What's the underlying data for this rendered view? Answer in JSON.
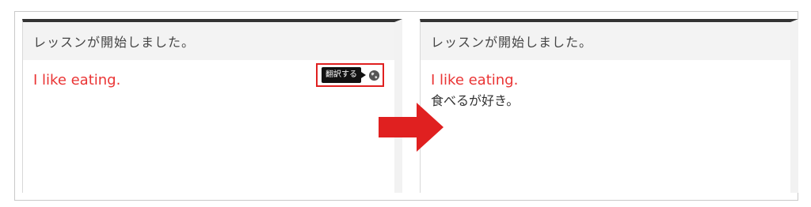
{
  "left_panel": {
    "header": "レッスンが開始しました。",
    "message_en": "I like eating.",
    "translate_button": "翻訳する",
    "globe_icon": "globe-icon"
  },
  "right_panel": {
    "header": "レッスンが開始しました。",
    "message_en": "I like eating.",
    "message_ja": "食べるが好き。"
  },
  "arrow_icon": "right-arrow-icon",
  "colors": {
    "english_text": "#ea3434",
    "highlight_box": "#e02020",
    "arrow": "#e02020",
    "top_border": "#333333",
    "header_bg": "#f3f3f3"
  }
}
